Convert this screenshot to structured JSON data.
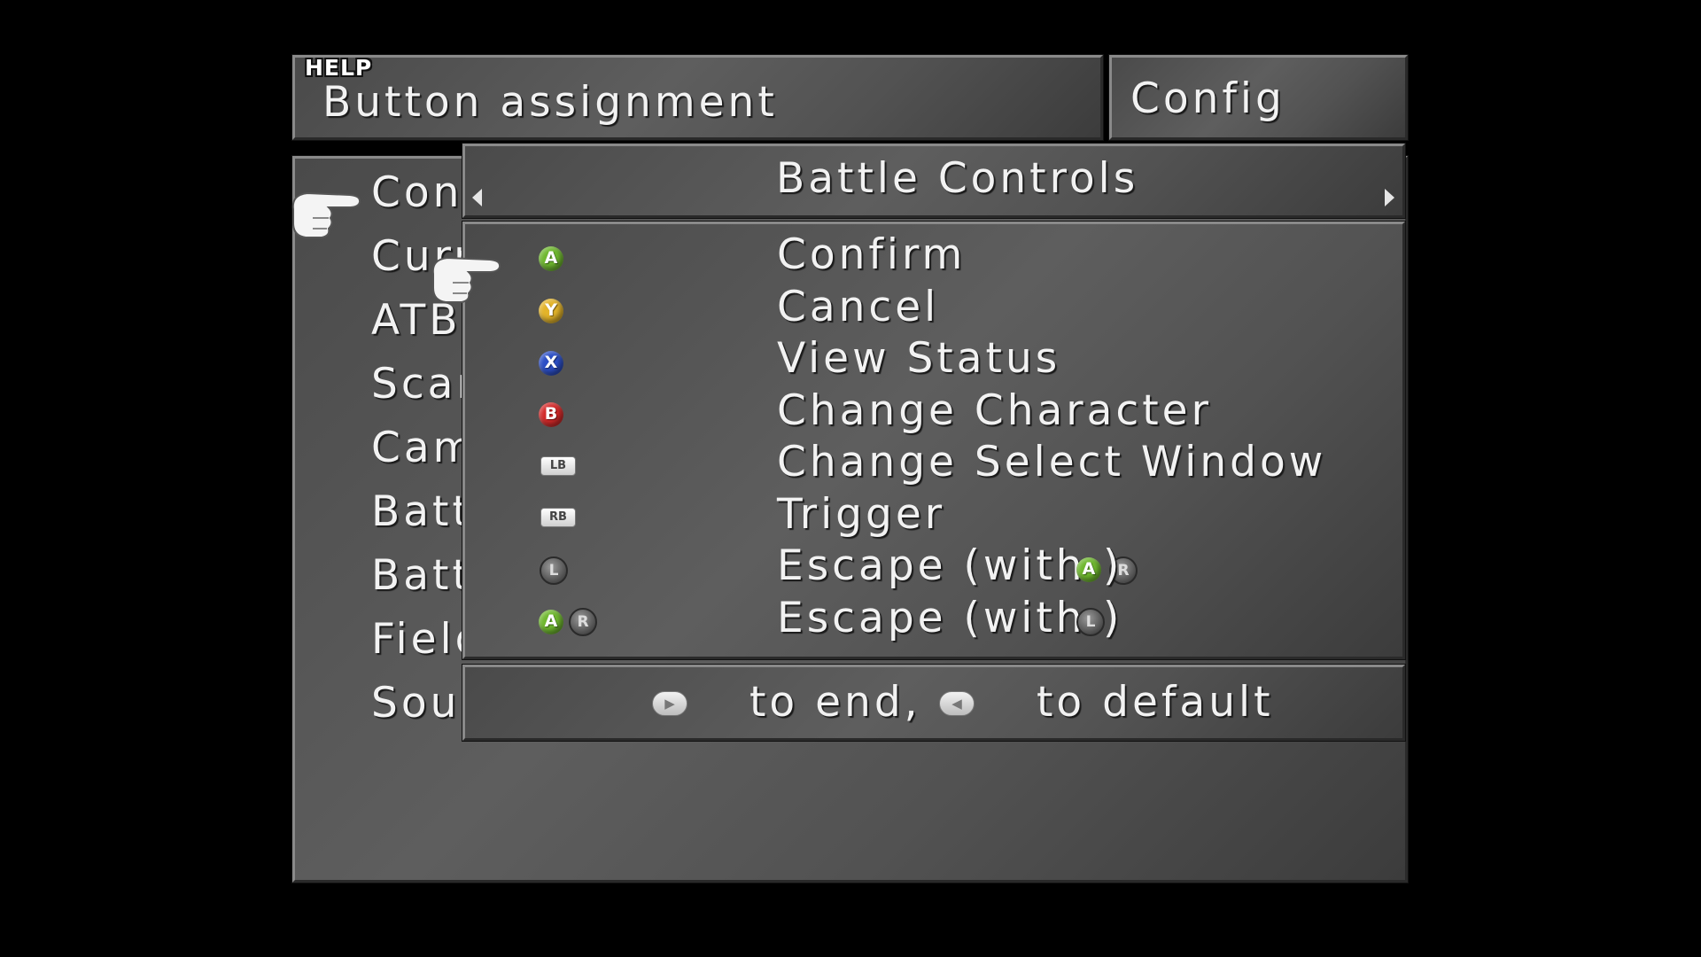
{
  "help_label": "HELP",
  "help_text": "Button assignment",
  "title": "Config",
  "menu": [
    "Cont",
    "Curr",
    "ATB",
    "Scar",
    "Came",
    "Batt",
    "Batt",
    "Field",
    "Soun"
  ],
  "section_title": "Battle Controls",
  "assignments": [
    {
      "button_icon": "a-button-icon",
      "button_label": "A",
      "action": "Confirm"
    },
    {
      "button_icon": "y-button-icon",
      "button_label": "Y",
      "action": "Cancel"
    },
    {
      "button_icon": "x-button-icon",
      "button_label": "X",
      "action": "View Status"
    },
    {
      "button_icon": "b-button-icon",
      "button_label": "B",
      "action": "Change Character"
    },
    {
      "button_icon": "left-bumper-icon",
      "button_label": "LB",
      "action": "Change Select Window"
    },
    {
      "button_icon": "right-bumper-icon",
      "button_label": "RB",
      "action": "Trigger"
    },
    {
      "button_icon": "left-stick-icon",
      "button_label": "L",
      "action": "Escape (with",
      "suffix": ")"
    },
    {
      "button_icon": "a-r-combo-icon",
      "button_label": "A R",
      "action": "Escape (with",
      "suffix": ")"
    }
  ],
  "footer": {
    "end_text": "to end,",
    "default_text": "to default"
  },
  "colors": {
    "a": "#6fb82f",
    "y": "#e3b42a",
    "x": "#2c4fc6",
    "b": "#d42a2a"
  }
}
